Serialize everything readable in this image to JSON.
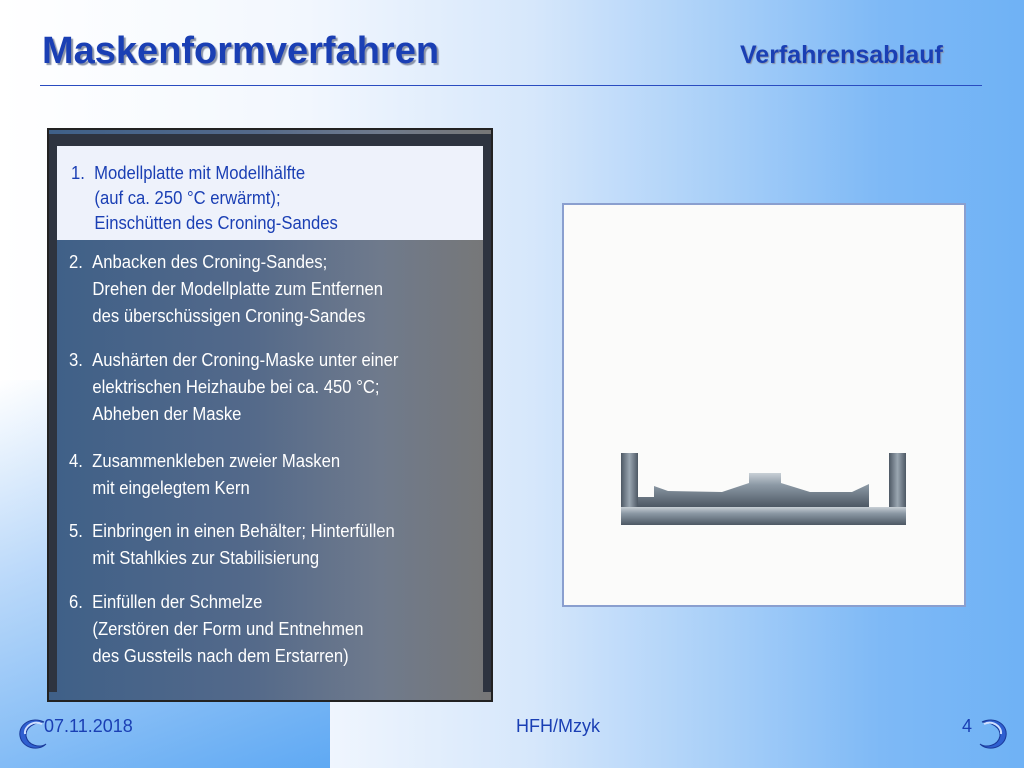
{
  "header": {
    "title": "Maskenformverfahren",
    "subtitle": "Verfahrensablauf"
  },
  "steps": [
    {
      "number": "1.",
      "lines": [
        "Modellplatte mit Modellhälfte",
        "(auf ca. 250 °C erwärmt);",
        "Einschütten des Croning-Sandes"
      ]
    },
    {
      "number": "2.",
      "lines": [
        "Anbacken des Croning-Sandes;",
        "Drehen der Modellplatte zum Entfernen",
        "des überschüssigen Croning-Sandes"
      ]
    },
    {
      "number": "3.",
      "lines": [
        "Aushärten der Croning-Maske unter einer",
        "elektrischen Heizhaube bei ca. 450 °C;",
        "Abheben der Maske"
      ]
    },
    {
      "number": "4.",
      "lines": [
        "Zusammenkleben zweier Masken",
        "mit eingelegtem Kern"
      ]
    },
    {
      "number": "5.",
      "lines": [
        "Einbringen in einen Behälter; Hinterfüllen",
        "mit Stahlkies zur Stabilisierung"
      ]
    },
    {
      "number": "6.",
      "lines": [
        "Einfüllen der Schmelze",
        "(Zerstören der Form und Entnehmen",
        "des Gussteils nach dem Erstarren)"
      ]
    }
  ],
  "footer": {
    "date": "07.11.2018",
    "author": "HFH/Mzyk",
    "page": "4"
  },
  "colors": {
    "accent": "#1a3fb4",
    "highlight": "#eef2fb",
    "metal": "#7d8a96"
  },
  "icons": {
    "prev": "swirl-arrow-left-icon",
    "next": "swirl-arrow-right-icon"
  }
}
